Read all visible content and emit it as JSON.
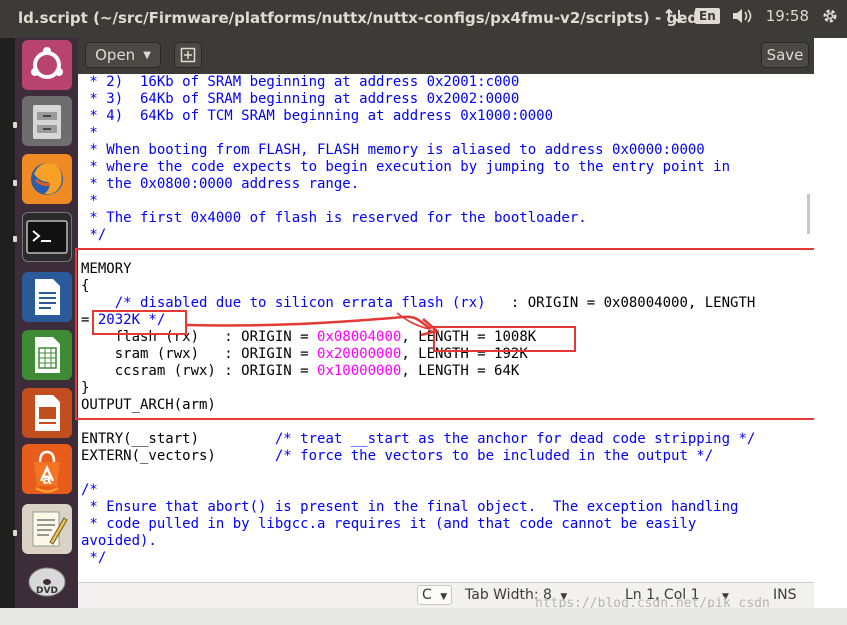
{
  "window": {
    "title": "ld.script (~/src/Firmware/platforms/nuttx/nuttx-configs/px4fmu-v2/scripts) - gedit"
  },
  "tray": {
    "input_method": "En",
    "clock": "19:58"
  },
  "launcher": {
    "items": [
      "ubuntu-dash-icon",
      "files-icon",
      "firefox-icon",
      "terminal-icon",
      "writer-icon",
      "calc-icon",
      "impress-icon",
      "software-center-icon",
      "amazon-icon",
      "text-editor-icon",
      "dvd-icon"
    ]
  },
  "toolbar": {
    "open_label": "Open",
    "save_label": "Save"
  },
  "editor": {
    "lines": [
      [
        {
          "t": " * 2)  16Kb of SRAM beginning at address 0x2001:c000",
          "c": "c"
        }
      ],
      [
        {
          "t": " * 3)  64Kb of SRAM beginning at address 0x2002:0000",
          "c": "c"
        }
      ],
      [
        {
          "t": " * 4)  64Kb of TCM SRAM beginning at address 0x1000:0000",
          "c": "c"
        }
      ],
      [
        {
          "t": " *",
          "c": "c"
        }
      ],
      [
        {
          "t": " * When booting from FLASH, FLASH memory is aliased to address 0x0000:0000",
          "c": "c"
        }
      ],
      [
        {
          "t": " * where the code expects to begin execution by jumping to the entry point in",
          "c": "c"
        }
      ],
      [
        {
          "t": " * the 0x0800:0000 address range.",
          "c": "c"
        }
      ],
      [
        {
          "t": " *",
          "c": "c"
        }
      ],
      [
        {
          "t": " * The first 0x4000 of flash is reserved for the bootloader.",
          "c": "c"
        }
      ],
      [
        {
          "t": " */",
          "c": "c"
        }
      ],
      [
        {
          "t": ""
        }
      ],
      [
        {
          "t": "MEMORY"
        }
      ],
      [
        {
          "t": "{"
        }
      ],
      [
        {
          "t": "    "
        },
        {
          "t": "/* disabled due to silicon errata flash (rx)",
          "c": "c"
        },
        {
          "t": "   : ORIGIN = 0x08004000, LENGTH"
        }
      ],
      [
        {
          "t": "= "
        },
        {
          "t": "2032K */",
          "c": "c"
        }
      ],
      [
        {
          "t": "    flash (rx)   : ORIGIN = "
        },
        {
          "t": "0x08004000",
          "c": "m"
        },
        {
          "t": ", LENGTH = 1008K"
        }
      ],
      [
        {
          "t": "    sram (rwx)   : ORIGIN = "
        },
        {
          "t": "0x20000000",
          "c": "m"
        },
        {
          "t": ", LENGTH = 192K"
        }
      ],
      [
        {
          "t": "    ccsram (rwx) : ORIGIN = "
        },
        {
          "t": "0x10000000",
          "c": "m"
        },
        {
          "t": ", LENGTH = 64K"
        }
      ],
      [
        {
          "t": "}"
        }
      ],
      [
        {
          "t": "OUTPUT_ARCH(arm)"
        }
      ],
      [
        {
          "t": ""
        }
      ],
      [
        {
          "t": "ENTRY(__start)         "
        },
        {
          "t": "/* treat __start as the anchor for dead code stripping */",
          "c": "c"
        }
      ],
      [
        {
          "t": "EXTERN(_vectors)       "
        },
        {
          "t": "/* force the vectors to be included in the output */",
          "c": "c"
        }
      ],
      [
        {
          "t": ""
        }
      ],
      [
        {
          "t": "/*",
          "c": "c"
        }
      ],
      [
        {
          "t": " * Ensure that abort() is present in the final object.  The exception handling",
          "c": "c"
        }
      ],
      [
        {
          "t": " * code pulled in by libgcc.a requires it (and that code cannot be easily",
          "c": "c"
        }
      ],
      [
        {
          "t": "avoided).",
          "c": "c"
        }
      ],
      [
        {
          "t": " */",
          "c": "c"
        }
      ]
    ]
  },
  "statusbar": {
    "language": "C",
    "tab_width": "Tab Width: 8",
    "position": "Ln 1, Col 1",
    "mode": "INS"
  },
  "watermark": "https://blog.csdn.net/pik_csdn",
  "colors": {
    "annotation": "#e53935",
    "comment": "#0000ff",
    "constant": "#ff00ff"
  }
}
